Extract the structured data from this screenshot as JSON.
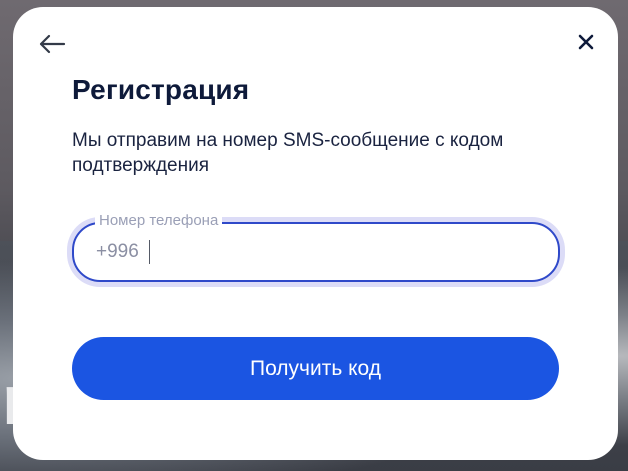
{
  "background": {
    "partial_text": "r"
  },
  "modal": {
    "title": "Регистрация",
    "subtitle": "Мы отправим на номер SMS-сообщение с кодом подтверждения",
    "phone": {
      "label": "Номер телефона",
      "value": "+996"
    },
    "submit_label": "Получить код",
    "icons": {
      "back": "arrow-left-icon",
      "close": "close-icon"
    }
  },
  "colors": {
    "accent": "#1b55e2",
    "title": "#0e1a3a",
    "field_border": "#2f49c9",
    "field_glow": "#dcdcf7"
  }
}
